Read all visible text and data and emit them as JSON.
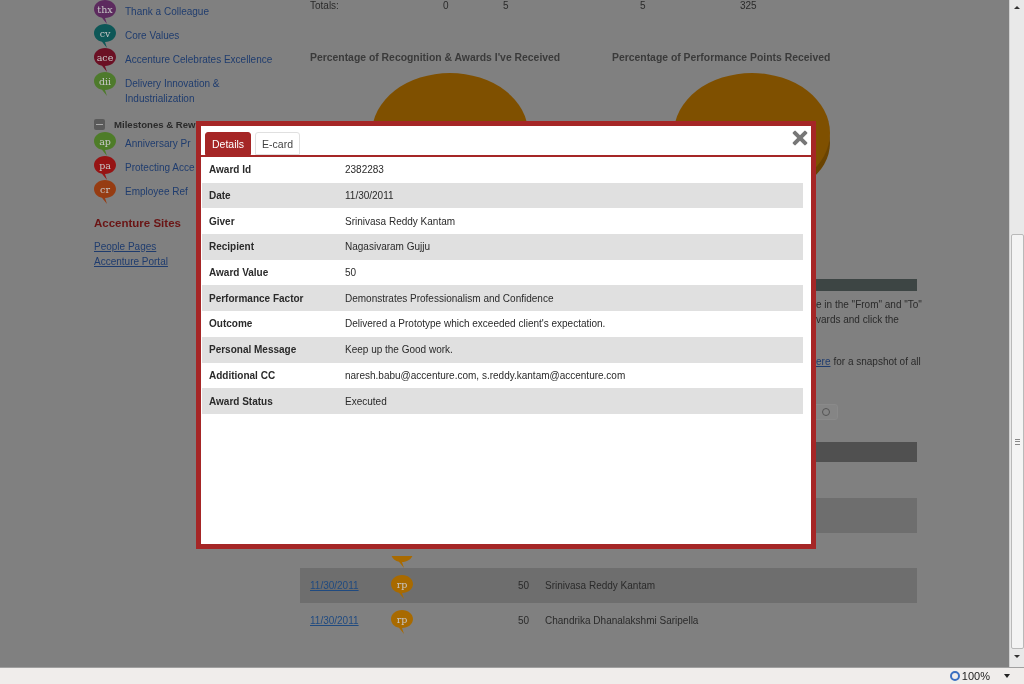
{
  "sidebar": {
    "items": [
      {
        "badge": "thx",
        "label": "Thank a Colleague",
        "color": "#5c2a5e"
      },
      {
        "badge": "cv",
        "label": "Core Values",
        "color": "#0e5757"
      },
      {
        "badge": "ace",
        "label": "Accenture Celebrates Excellence",
        "color": "#6b1024"
      },
      {
        "badge": "dii",
        "label": "Delivery Innovation & Industrialization",
        "color": "#4e7a2c"
      }
    ],
    "milestones": {
      "title": "Milestones & Rew",
      "expanded": true,
      "items": [
        {
          "badge": "ap",
          "label": "Anniversary Pr",
          "color": "#4e7c28"
        },
        {
          "badge": "pa",
          "label": "Protecting Acce",
          "color": "#961414"
        },
        {
          "badge": "cr",
          "label": "Employee Ref",
          "color": "#963c12"
        }
      ]
    },
    "sites": {
      "title": "Accenture Sites",
      "links": [
        "People Pages",
        "Accenture Portal"
      ]
    }
  },
  "totals": {
    "label": "Totals:",
    "values": [
      "0",
      "5",
      "5",
      "325"
    ]
  },
  "chart_titles": [
    "Percentage of Recognition & Awards I've Received",
    "Percentage of Performance Points Received"
  ],
  "instructions": [
    "e in the \"From\" and \"To\"",
    "vards and click the"
  ],
  "snapshot": {
    "link": "ere",
    "text": "for a snapshot of all"
  },
  "awards": [
    {
      "striped": true
    },
    {
      "striped": false,
      "partial_badge": true
    },
    {
      "striped": true,
      "date": "11/30/2011",
      "badge": "rp",
      "points": "50",
      "name": "Srinivasa Reddy Kantam"
    },
    {
      "striped": false,
      "date": "11/30/2011",
      "badge": "rp",
      "points": "50",
      "name": "Chandrika Dhanalakshmi Saripella"
    }
  ],
  "modal": {
    "tabs": [
      {
        "label": "Details",
        "selected": true
      },
      {
        "label": "E-card",
        "selected": false
      }
    ],
    "fields": [
      {
        "label": "Award Id",
        "value": "2382283"
      },
      {
        "label": "Date",
        "value": "11/30/2011"
      },
      {
        "label": "Giver",
        "value": "Srinivasa Reddy Kantam"
      },
      {
        "label": "Recipient",
        "value": "Nagasivaram Gujju"
      },
      {
        "label": "Award Value",
        "value": "50"
      },
      {
        "label": "Performance Factor",
        "value": "Demonstrates Professionalism and Confidence"
      },
      {
        "label": "Outcome",
        "value": "Delivered a Prototype which exceeded client's expectation."
      },
      {
        "label": "Personal Message",
        "value": "Keep up the Good work."
      },
      {
        "label": "Additional CC",
        "value": "naresh.babu@accenture.com, s.reddy.kantam@accenture.com"
      },
      {
        "label": "Award Status",
        "value": "Executed"
      }
    ]
  },
  "status_bar": {
    "zoom": "100%"
  }
}
